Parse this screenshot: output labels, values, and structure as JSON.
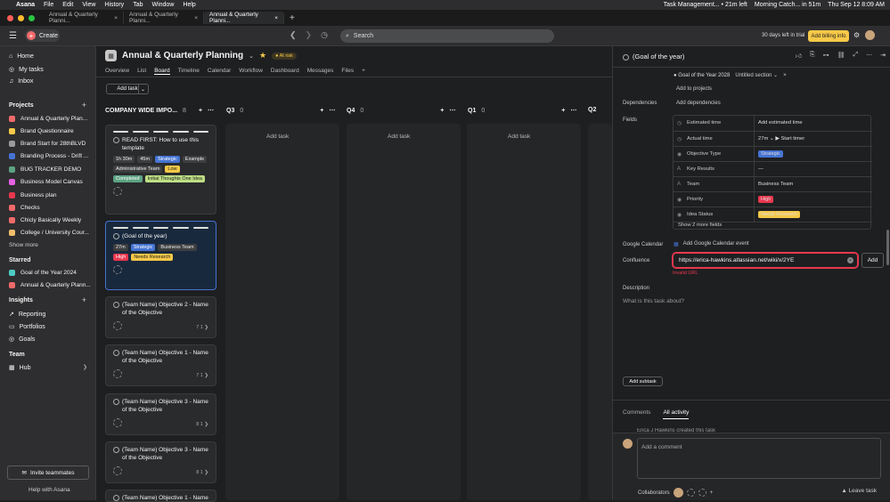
{
  "menubar": {
    "app": "Asana",
    "items": [
      "File",
      "Edit",
      "View",
      "History",
      "Tab",
      "Window",
      "Help"
    ],
    "status_task": "Task Management... • 21m left",
    "status_event": "Morning Catch... in 51m",
    "datetime": "Thu Sep 12  8:09 AM"
  },
  "browser_tabs": [
    "Annual & Quarterly Planni...",
    "Annual & Quarterly Planni...",
    "Annual & Quarterly Planni..."
  ],
  "topbar": {
    "create_label": "Create",
    "search_placeholder": "Search",
    "trial_text": "30 days left in trial",
    "billing_label": "Add billing info"
  },
  "sidebar": {
    "nav": [
      "Home",
      "My tasks",
      "Inbox"
    ],
    "projects_heading": "Projects",
    "projects": [
      {
        "label": "Annual & Quarterly Plan...",
        "color": "#f06a6a"
      },
      {
        "label": "Brand Questionnaire",
        "color": "#f7c948"
      },
      {
        "label": "Brand Start for 28thBLVD",
        "color": "#9a9a9a"
      },
      {
        "label": "Branding Process - Drift ...",
        "color": "#4573d2"
      },
      {
        "label": "BUG TRACKER DEMO",
        "color": "#5da283"
      },
      {
        "label": "Business Model Canvas",
        "color": "#e362e3"
      },
      {
        "label": "Business plan",
        "color": "#e8384f"
      },
      {
        "label": "Checks",
        "color": "#f06a6a"
      },
      {
        "label": "Chicly Basically Weekly",
        "color": "#f06a6a"
      },
      {
        "label": "College / University Cour...",
        "color": "#f1bd6c"
      }
    ],
    "show_more": "Show more",
    "starred_heading": "Starred",
    "starred": [
      {
        "label": "Goal of the Year 2024",
        "color": "#4ecbc4"
      },
      {
        "label": "Annual & Quarterly Plann...",
        "color": "#f06a6a"
      }
    ],
    "insights_heading": "Insights",
    "insights": [
      "Reporting",
      "Portfolios",
      "Goals"
    ],
    "team_heading": "Team",
    "team": [
      "Hub"
    ],
    "invite_label": "Invite teammates",
    "help_label": "Help with Asana"
  },
  "project": {
    "title": "Annual & Quarterly Planning",
    "status": "At risk",
    "tabs": [
      "Overview",
      "List",
      "Board",
      "Timeline",
      "Calendar",
      "Workflow",
      "Dashboard",
      "Messages",
      "Files"
    ],
    "active_tab": "Board",
    "add_task": "Add task"
  },
  "board": {
    "columns": [
      {
        "name": "COMPANY WIDE IMPO...",
        "count": "8"
      },
      {
        "name": "Q3",
        "count": "0"
      },
      {
        "name": "Q4",
        "count": "0"
      },
      {
        "name": "Q1",
        "count": "0"
      },
      {
        "name": "Q2",
        "count": ""
      }
    ],
    "add_task_link": "Add task",
    "cards": [
      {
        "title": "READ FIRST: How to use this template",
        "tags": [
          "1h 30m",
          "45m",
          "Strategic",
          "Example",
          "Administrative Team",
          "Low",
          "Completed",
          "Initial Thoughts One Idea"
        ]
      },
      {
        "title": "(Goal of the year)",
        "tags": [
          "27m",
          "Strategic",
          "Business Team",
          "High",
          "Needs Research"
        ]
      },
      {
        "title": "(Team Name) Objective 2 - Name of the Objective",
        "meta": "7 1 ❯"
      },
      {
        "title": "(Team Name) Objective 1 - Name of the Objective",
        "meta": "7 1 ❯"
      },
      {
        "title": "(Team Name) Objective 3 - Name of the Objective",
        "meta": "8 1 ❯"
      },
      {
        "title": "(Team Name) Objective 3 - Name of the Objective",
        "meta": "8 1 ❯"
      },
      {
        "title": "(Team Name) Objective 1 - Name"
      }
    ]
  },
  "panel": {
    "title": "(Goal of the year)",
    "goal_link": "Goal of the Year 2028",
    "section": "Untitled section",
    "add_to_projects": "Add to projects",
    "dependencies_label": "Dependencies",
    "add_dependencies": "Add dependencies",
    "fields_label": "Fields",
    "fields": [
      {
        "key": "Estimated time",
        "value": "Add estimated time"
      },
      {
        "key": "Actual time",
        "value": "27m",
        "extra": "Start timer"
      },
      {
        "key": "Objective Type",
        "value": "Strategic"
      },
      {
        "key": "Key Results",
        "value": "—"
      },
      {
        "key": "Team",
        "value": "Business Team"
      },
      {
        "key": "Priority",
        "value": "High"
      },
      {
        "key": "Idea Status",
        "value": "Needs Research"
      }
    ],
    "show_more_fields": "Show 2 more fields",
    "google_calendar_label": "Google Calendar",
    "google_calendar_action": "Add Google Calendar event",
    "confluence_label": "Confluence",
    "confluence_value": "https://erica-hawkins.atlassian.net/wiki/x/2YE",
    "confluence_add": "Add",
    "invalid_text": "Invalid URL",
    "description_label": "Description",
    "description_placeholder": "What is this task about?",
    "add_subtask": "Add subtask",
    "activity_tabs": [
      "Comments",
      "All activity"
    ],
    "activity_peek": "Erica J Hawkins created this task",
    "comment_placeholder": "Add a comment",
    "collaborators_label": "Collaborators",
    "leave_task": "Leave task"
  }
}
